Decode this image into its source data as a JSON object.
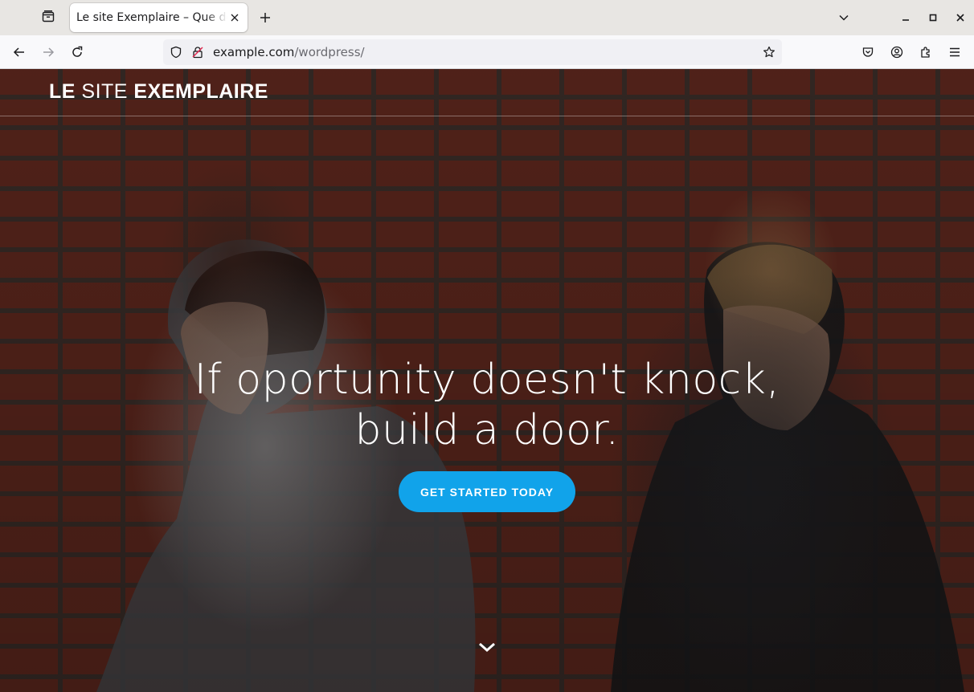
{
  "browser": {
    "tab": {
      "title": "Le site Exemplaire – Que de vrais exemples"
    },
    "url": {
      "domain": "example.com",
      "path": "/wordpress/"
    }
  },
  "site": {
    "title_part1": "LE",
    "title_part2": " SITE ",
    "title_part3": "EXEMPLAIRE"
  },
  "hero": {
    "heading_line1": "If oportunity doesn't knock,",
    "heading_line2": "build a door.",
    "cta_label": "GET STARTED TODAY"
  },
  "colors": {
    "cta": "#11a3ea",
    "tabbar": "#e8e6e3",
    "navbar": "#f9f9fb"
  }
}
